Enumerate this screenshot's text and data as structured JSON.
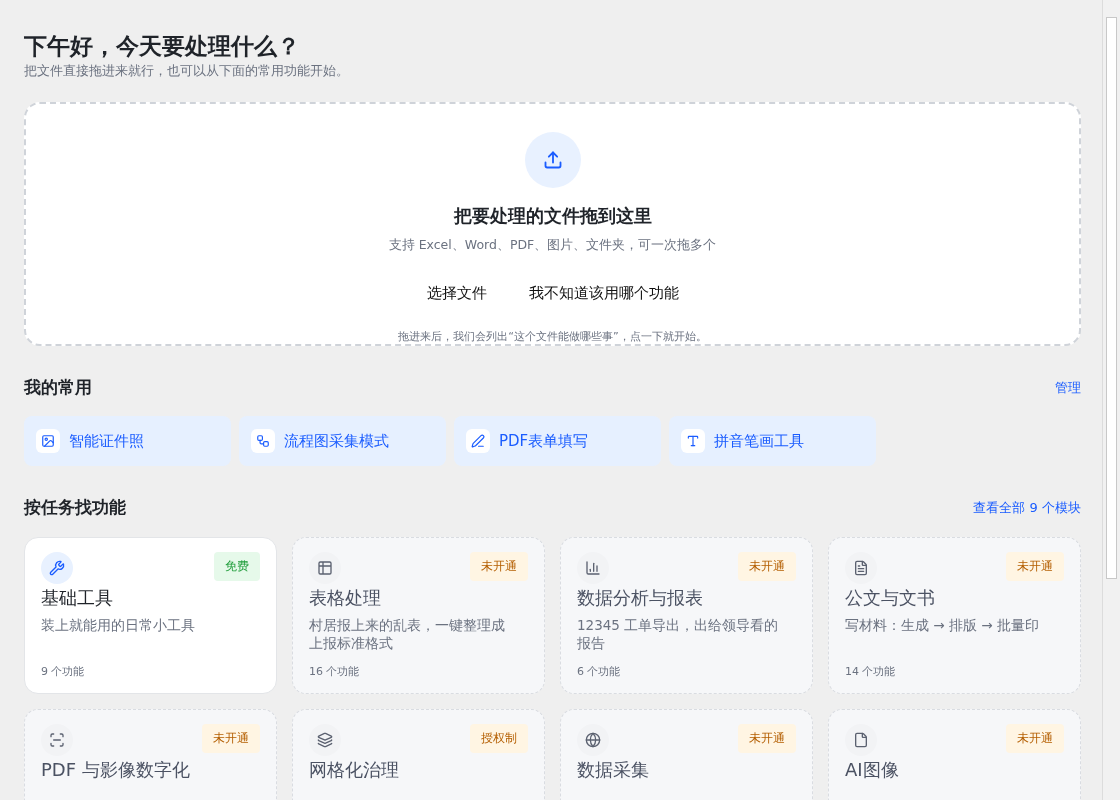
{
  "header": {
    "title": "下午好，今天要处理什么？",
    "subtitle": "把文件直接拖进来就行，也可以从下面的常用功能开始。"
  },
  "dropzone": {
    "title": "把要处理的文件拖到这里",
    "hint": "支持 Excel、Word、PDF、图片、文件夹，可一次拖多个",
    "buttons": [
      "选择文件",
      "我不知道该用哪个功能"
    ],
    "note": "拖进来后，我们会列出“这个文件能做哪些事”，点一下就开始。"
  },
  "favorites": {
    "title": "我的常用",
    "action": "管理",
    "items": [
      {
        "label": "智能证件照"
      },
      {
        "label": "流程图采集模式"
      },
      {
        "label": "PDF表单填写"
      },
      {
        "label": "拼音笔画工具"
      }
    ]
  },
  "tasks": {
    "title": "按任务找功能",
    "action": "查看全部 9 个模块",
    "cards": [
      {
        "title": "基础工具",
        "desc": "装上就能用的日常小工具",
        "count": "9 个功能",
        "badge": "免费",
        "enabled": true
      },
      {
        "title": "表格处理",
        "desc": "村居报上来的乱表，一键整理成上报标准格式",
        "count": "16 个功能",
        "badge": "未开通",
        "enabled": false
      },
      {
        "title": "数据分析与报表",
        "desc": "12345 工单导出，出给领导看的报告",
        "count": "6 个功能",
        "badge": "未开通",
        "enabled": false
      },
      {
        "title": "公文与文书",
        "desc": "写材料：生成 → 排版 → 批量印",
        "count": "14 个功能",
        "badge": "未开通",
        "enabled": false
      },
      {
        "title": "PDF 与影像数字化",
        "badge": "未开通",
        "enabled": false
      },
      {
        "title": "网格化治理",
        "badge": "授权制",
        "enabled": false
      },
      {
        "title": "数据采集",
        "badge": "未开通",
        "enabled": false
      },
      {
        "title": "AI图像",
        "badge": "未开通",
        "enabled": false
      }
    ]
  }
}
